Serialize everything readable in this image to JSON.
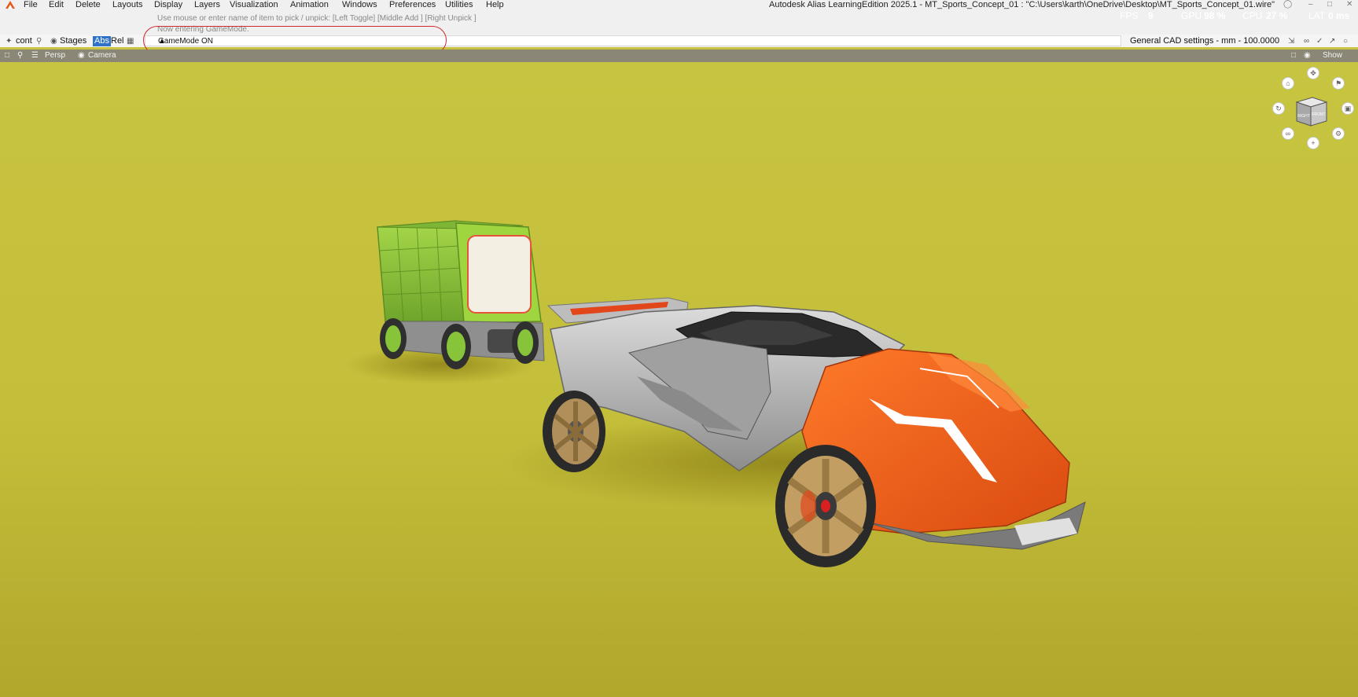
{
  "menu": [
    "File",
    "Edit",
    "Delete",
    "Layouts",
    "Display",
    "Layers",
    "Visualization",
    "Animation",
    "Windows",
    "Preferences",
    "Utilities",
    "Help"
  ],
  "app_title": "Autodesk Alias LearningEdition 2025.1   -   MT_Sports_Concept_01 : \"C:\\Users\\karth\\OneDrive\\Desktop\\MT_Sports_Concept_01.wire\"",
  "stats": {
    "fps_label": "FPS",
    "fps_value": "9",
    "gpu_label": "GPU",
    "gpu_value": "98 %",
    "cpu_label": "CPU",
    "cpu_value": "27 %",
    "lat_label": "LAT",
    "lat_value": "0 ms"
  },
  "prompt": {
    "line1": "Use mouse or enter name of item to pick / unpick: [Left Toggle] [Middle Add ] [Right Unpick ]",
    "line2": "Now entering GameMode."
  },
  "toolbar": {
    "cont": "cont",
    "stages": "Stages",
    "abs": "Abs",
    "rel": "Rel",
    "command_value": "GameMode ON",
    "cad_settings": "General CAD settings  -  mm  -  100.0000"
  },
  "viewport_header": {
    "persp": "Persp",
    "camera": "Camera",
    "show": "Show"
  },
  "viewcube": {
    "face_right": "RIGHT",
    "face_front": "FRONT"
  },
  "colors": {
    "background": "#c9c43f",
    "car_orange": "#f05a14",
    "trailer_green": "#8fc63a",
    "highlight": "#d2272d"
  }
}
